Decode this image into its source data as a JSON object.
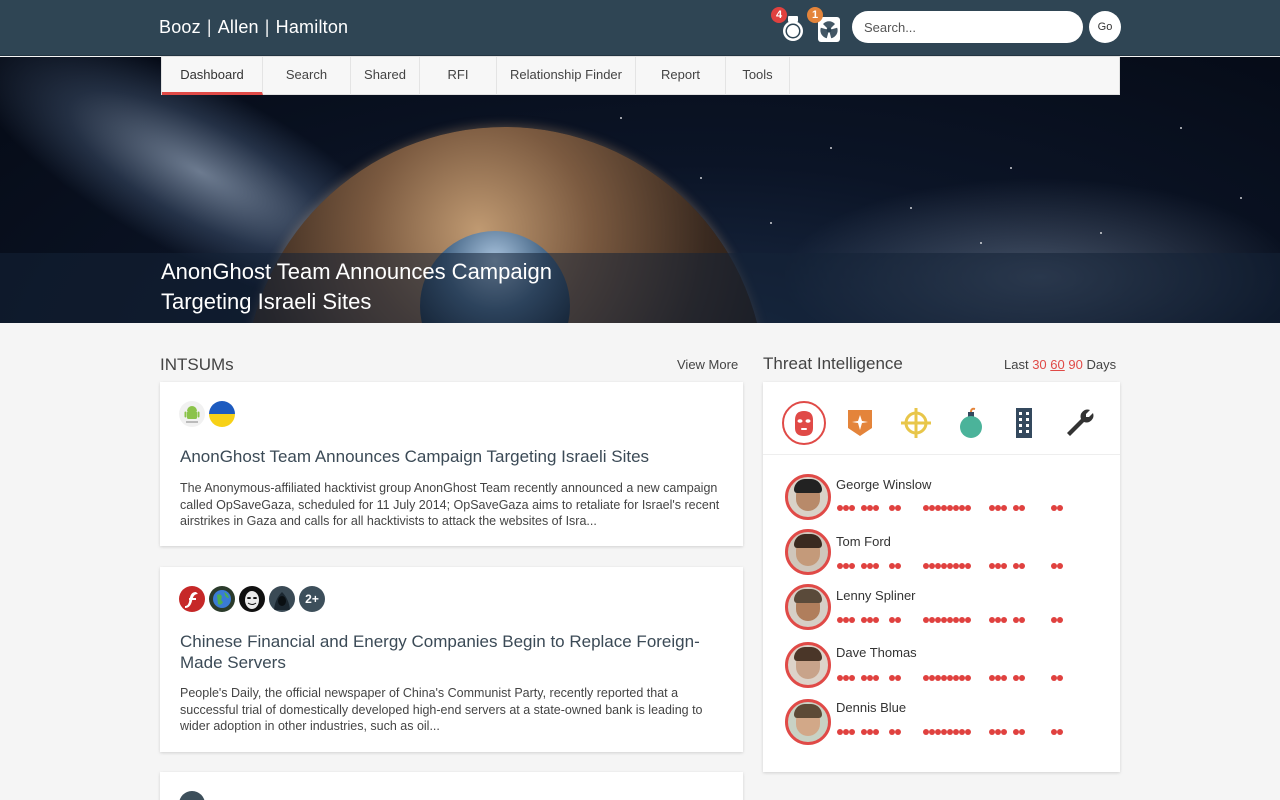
{
  "brand": {
    "part1": "Booz",
    "part2": "Allen",
    "part3": "Hamilton",
    "separator": "|"
  },
  "alerts": [
    {
      "icon": "grenade-icon",
      "count": "4",
      "color": "#e0413f"
    },
    {
      "icon": "radiation-icon",
      "count": "1",
      "color": "#e4843a"
    }
  ],
  "search": {
    "placeholder": "Search...",
    "value": "",
    "button_label": "Go"
  },
  "nav": {
    "tabs": [
      {
        "label": "Dashboard",
        "active": true
      },
      {
        "label": "Search"
      },
      {
        "label": "Shared"
      },
      {
        "label": "RFI"
      },
      {
        "label": "Relationship Finder"
      },
      {
        "label": "Report"
      },
      {
        "label": "Tools"
      }
    ]
  },
  "hero": {
    "title": "AnonGhost Team Announces Campaign Targeting Israeli Sites"
  },
  "intsums": {
    "title": "INTSUMs",
    "view_more": "View More",
    "cards": [
      {
        "icons": [
          "android-icon",
          "ukraine-flag-icon"
        ],
        "title": "AnonGhost Team Announces Campaign Targeting Israeli Sites",
        "body": "The Anonymous-affiliated hacktivist group AnonGhost Team recently announced a new campaign called OpSaveGaza, scheduled for 11 July 2014; OpSaveGaza aims to retaliate for Israel's recent airstrikes in Gaza and calls for all hacktivists to attack the websites of Isra..."
      },
      {
        "icons": [
          "flash-icon",
          "globe-icon",
          "anonymous-mask-icon",
          "hacker-icon"
        ],
        "more_badge": "2+",
        "title": "Chinese Financial and Energy Companies Begin to Replace Foreign-Made Servers",
        "body": "People's Daily, the official newspaper of China's Communist Party, recently reported that a successful trial of domestically developed high-end servers at a state-owned bank is leading to wider adoption in other industries, such as oil..."
      }
    ]
  },
  "threat": {
    "title": "Threat Intelligence",
    "range_prefix": "Last",
    "ranges": [
      "30",
      "60",
      "90"
    ],
    "active_range": "60",
    "range_suffix": "Days",
    "categories": [
      {
        "icon": "threat-actor-mask-icon",
        "color": "#e04a47",
        "active": true
      },
      {
        "icon": "badge-icon",
        "color": "#e4843a"
      },
      {
        "icon": "crosshair-icon",
        "color": "#e8c64a"
      },
      {
        "icon": "bomb-icon",
        "color": "#4bb39a"
      },
      {
        "icon": "building-icon",
        "color": "#34495e"
      },
      {
        "icon": "wrench-icon",
        "color": "#333333"
      }
    ],
    "people": [
      {
        "name": "George Winslow"
      },
      {
        "name": "Tom Ford"
      },
      {
        "name": "Lenny Spliner"
      },
      {
        "name": "Dave Thomas"
      },
      {
        "name": "Dennis Blue"
      }
    ]
  }
}
